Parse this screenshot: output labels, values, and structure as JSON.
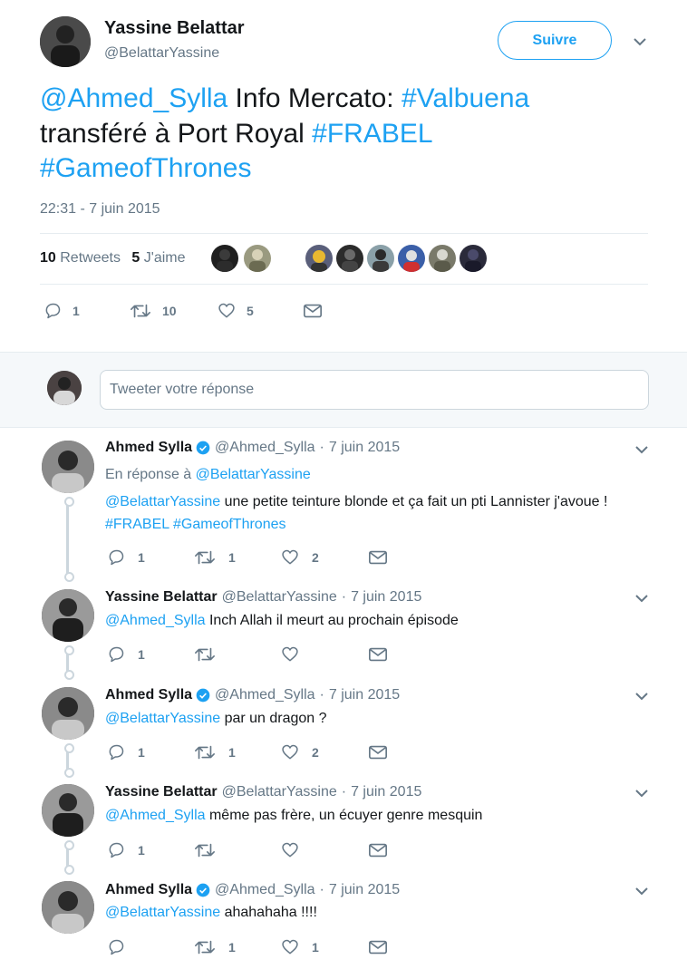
{
  "main_tweet": {
    "author_name": "Yassine Belattar",
    "author_handle": "@BelattarYassine",
    "follow_label": "Suivre",
    "text_parts": [
      "@Ahmed_Sylla",
      " Info Mercato: ",
      "#Valbuena",
      " transféré à Port Royal ",
      "#FRABEL",
      "#GameofThrones"
    ],
    "timestamp": "22:31 - 7 juin 2015",
    "retweets_count": "10",
    "retweets_label": "Retweets",
    "likes_count": "5",
    "likes_label": "J'aime",
    "actions": {
      "replies": "1",
      "retweets": "10",
      "likes": "5"
    }
  },
  "reply_box": {
    "placeholder": "Tweeter votre réponse"
  },
  "replies": [
    {
      "name": "Ahmed Sylla",
      "verified": true,
      "handle": "@Ahmed_Sylla",
      "dot": "·",
      "date": "7 juin 2015",
      "in_reply_prefix": "En réponse à ",
      "in_reply_handle": "@BelattarYassine",
      "mention": "@BelattarYassine",
      "text": " une petite teinture blonde et ça fait un pti Lannister j'avoue !",
      "hashtags": "#FRABEL #GameofThrones",
      "replies": "1",
      "retweets": "1",
      "likes": "2"
    },
    {
      "name": "Yassine Belattar",
      "verified": false,
      "handle": "@BelattarYassine",
      "dot": "·",
      "date": "7 juin 2015",
      "mention": "@Ahmed_Sylla",
      "text": " Inch Allah il meurt au prochain épisode",
      "replies": "1",
      "retweets": "",
      "likes": ""
    },
    {
      "name": "Ahmed Sylla",
      "verified": true,
      "handle": "@Ahmed_Sylla",
      "dot": "·",
      "date": "7 juin 2015",
      "mention": "@BelattarYassine",
      "text": " par un dragon ?",
      "replies": "1",
      "retweets": "1",
      "likes": "2"
    },
    {
      "name": "Yassine Belattar",
      "verified": false,
      "handle": "@BelattarYassine",
      "dot": "·",
      "date": "7 juin 2015",
      "mention": "@Ahmed_Sylla",
      "text": " même pas frère, un écuyer genre mesquin",
      "replies": "1",
      "retweets": "",
      "likes": ""
    },
    {
      "name": "Ahmed Sylla",
      "verified": true,
      "handle": "@Ahmed_Sylla",
      "dot": "·",
      "date": "7 juin 2015",
      "mention": "@BelattarYassine",
      "text": " ahahahaha !!!!",
      "replies": "",
      "retweets": "1",
      "likes": "1"
    }
  ],
  "colors": {
    "accent": "#1da1f2",
    "text": "#14171a",
    "muted": "#657786",
    "border": "#e6ecf0",
    "reply_bg": "#f5f8fa"
  },
  "icons": [
    "reply-icon",
    "retweet-icon",
    "like-icon",
    "message-icon",
    "chevron-down-icon",
    "verified-badge-icon"
  ]
}
